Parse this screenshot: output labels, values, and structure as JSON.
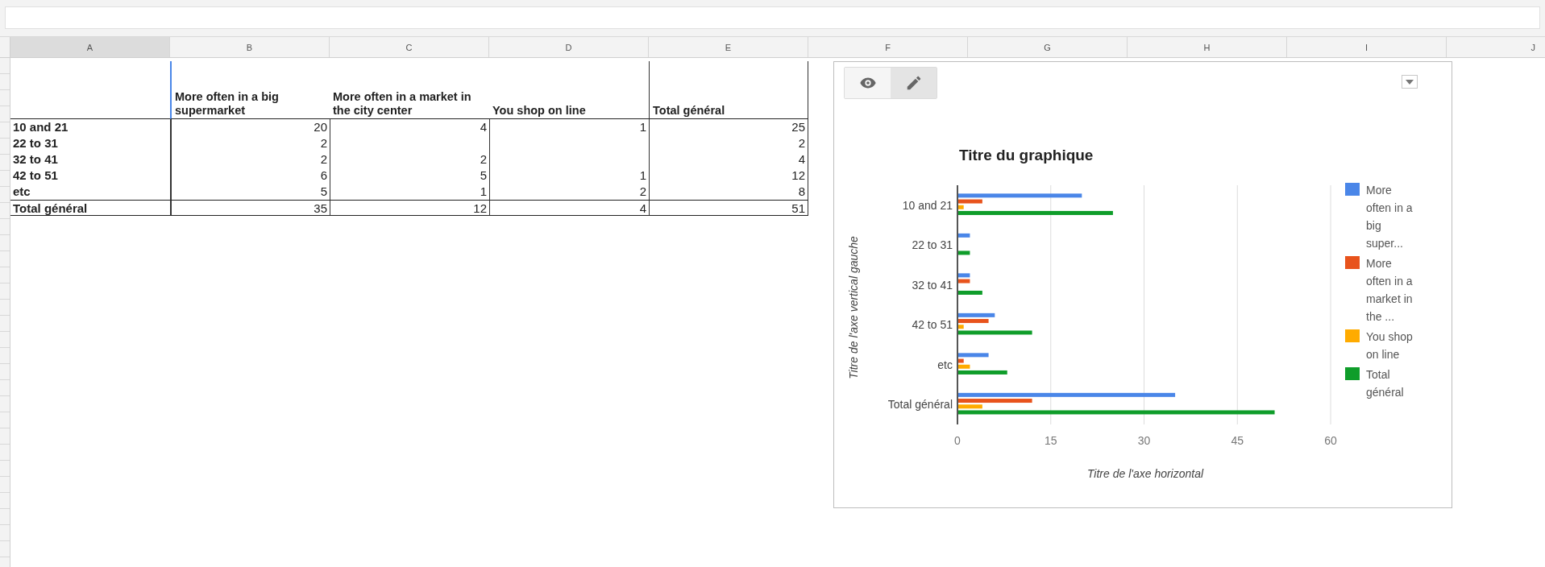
{
  "column_headers": [
    {
      "label": "A",
      "selected": true
    },
    {
      "label": "B",
      "selected": false
    },
    {
      "label": "C",
      "selected": false
    },
    {
      "label": "D",
      "selected": false
    },
    {
      "label": "E",
      "selected": false
    },
    {
      "label": "F",
      "selected": false
    },
    {
      "label": "G",
      "selected": false
    },
    {
      "label": "H",
      "selected": false
    },
    {
      "label": "I",
      "selected": false
    },
    {
      "label": "J",
      "selected": false
    }
  ],
  "table": {
    "header": [
      "More often in a big supermarket",
      "More often in a market in the city center",
      "You shop on line",
      "Total général"
    ],
    "rows": [
      {
        "kind": "data",
        "label": "10 and 21",
        "cells": [
          "20",
          "4",
          "1",
          "25"
        ]
      },
      {
        "kind": "data",
        "label": "22 to 31",
        "cells": [
          "2",
          null,
          null,
          "2"
        ]
      },
      {
        "kind": "data",
        "label": "32 to 41",
        "cells": [
          "2",
          "2",
          null,
          "4"
        ]
      },
      {
        "kind": "data",
        "label": "42 to 51",
        "cells": [
          "6",
          "5",
          "1",
          "12"
        ]
      },
      {
        "kind": "data",
        "label": "etc",
        "cells": [
          "5",
          "1",
          "2",
          "8"
        ]
      },
      {
        "kind": "total",
        "label": "Total général",
        "cells": [
          "35",
          "12",
          "4",
          "51"
        ]
      }
    ]
  },
  "chart": {
    "toolbar": [
      {
        "kind": "view",
        "selected": false
      },
      {
        "kind": "edit",
        "selected": true
      }
    ],
    "chart_data": {
      "type": "bar",
      "orientation": "horizontal",
      "title": "Titre du graphique",
      "xlabel": "Titre de l'axe horizontal",
      "ylabel": "Titre de l'axe vertical gauche",
      "categories": [
        "10 and 21",
        "22 to 31",
        "32 to 41",
        "42 to 51",
        "etc",
        "Total général"
      ],
      "series": [
        {
          "name": "More often in a big super...",
          "color": "#4a86e8",
          "values": [
            20,
            2,
            2,
            6,
            5,
            35
          ]
        },
        {
          "name": "More often in a market in the ...",
          "color": "#e8531c",
          "values": [
            4,
            null,
            2,
            5,
            1,
            12
          ]
        },
        {
          "name": "You shop on line",
          "color": "#ffab00",
          "values": [
            1,
            null,
            null,
            1,
            2,
            4
          ]
        },
        {
          "name": "Total général",
          "color": "#0f9d2a",
          "values": [
            25,
            2,
            4,
            12,
            8,
            51
          ]
        }
      ],
      "grid": true,
      "xlim": [
        0,
        60
      ],
      "xticks": [
        0,
        15,
        30,
        45,
        60
      ]
    }
  }
}
